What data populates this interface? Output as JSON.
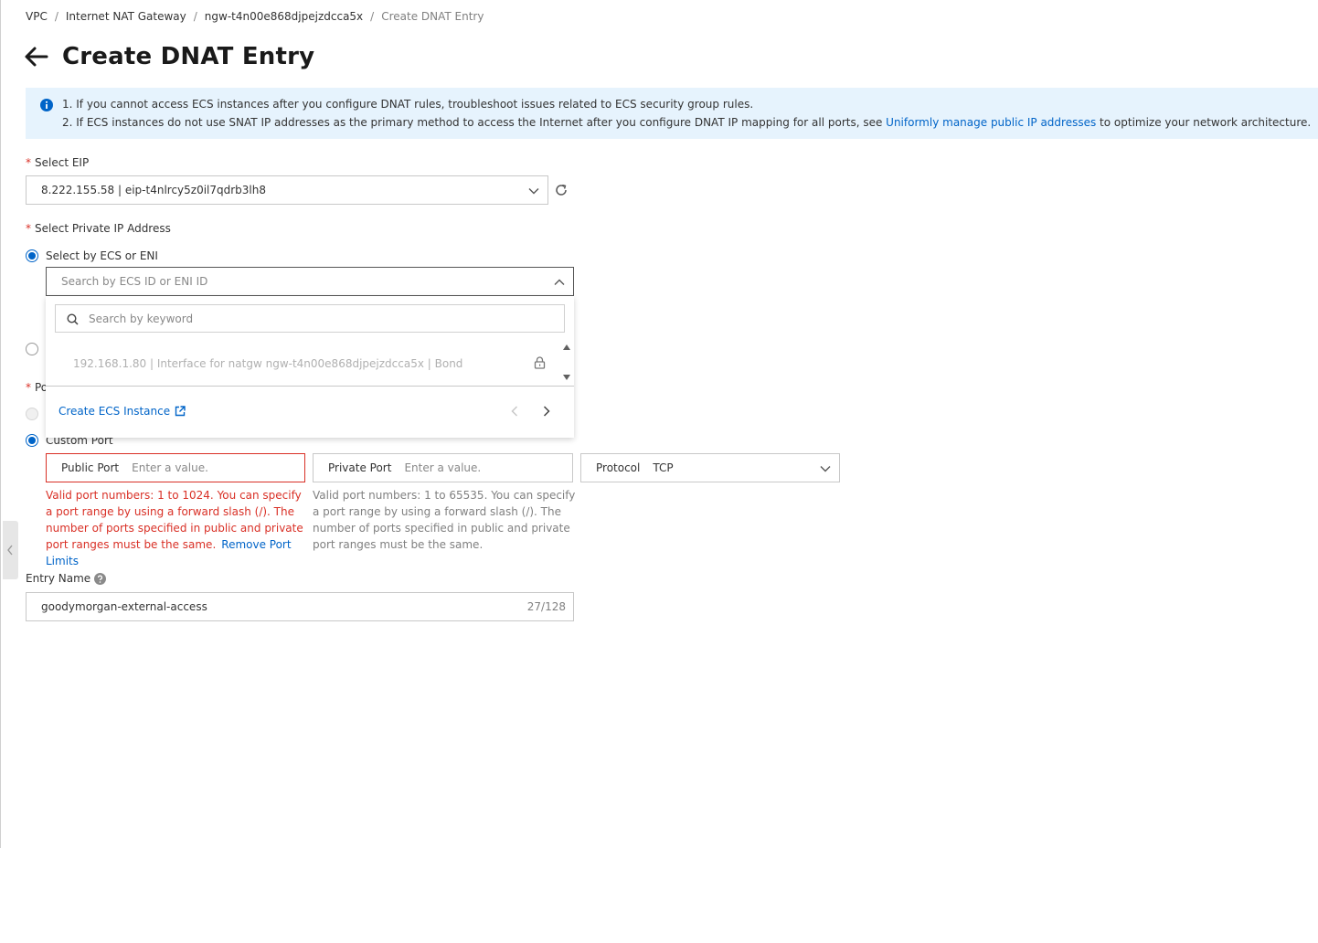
{
  "breadcrumb": {
    "vpc": "VPC",
    "nat": "Internet NAT Gateway",
    "gateway_id": "ngw-t4n00e868djpejzdcca5x",
    "current": "Create DNAT Entry",
    "separator": "/"
  },
  "title": "Create DNAT Entry",
  "notice": {
    "line1": "1. If you cannot access ECS instances after you configure DNAT rules, troubleshoot issues related to ECS security group rules.",
    "line2_prefix": "2. If ECS instances do not use SNAT IP addresses as the primary method to access the Internet after you configure DNAT IP mapping for all ports, see ",
    "line2_link": "Uniformly manage public IP addresses",
    "line2_suffix": " to optimize your network architecture."
  },
  "eip": {
    "label": "Select EIP",
    "value": "8.222.155.58 | eip-t4nlrcy5z0il7qdrb3lh8"
  },
  "private_ip": {
    "label": "Select Private IP Address",
    "option_ecs": "Select by ECS or ENI",
    "ecs_placeholder": "Search by ECS ID or ENI ID",
    "keyword_placeholder": "Search by keyword",
    "option_item": "192.168.1.80 | Interface for natgw ngw-t4n00e868djpejzdcca5x | Bond",
    "create_ecs": "Create ECS Instance"
  },
  "port": {
    "label_partial": "Po",
    "custom_port": "Custom Port",
    "public_label": "Public Port",
    "public_placeholder": "Enter a value.",
    "private_label": "Private Port",
    "private_placeholder": "Enter a value.",
    "protocol_label": "Protocol",
    "protocol_value": "TCP",
    "public_help": "Valid port numbers: 1 to 1024. You can specify a port range by using a forward slash (/). The number of ports specified in public and private port ranges must be the same.",
    "remove_limits": "Remove Port Limits",
    "private_help": "Valid port numbers: 1 to 65535. You can specify a port range by using a forward slash (/). The number of ports specified in public and private port ranges must be the same."
  },
  "entry_name": {
    "label": "Entry Name",
    "value": "goodymorgan-external-access",
    "count": "27/128"
  },
  "colors": {
    "primary": "#0064c8",
    "error": "#d93026",
    "notice_bg": "#e6f3fd"
  }
}
